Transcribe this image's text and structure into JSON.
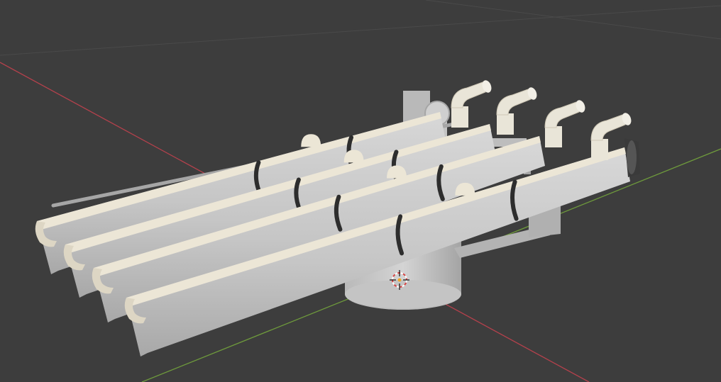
{
  "viewport": {
    "background": "#3d3d3d",
    "grid_color": "#4a4a4a",
    "x_axis_color": "#b4414c",
    "y_axis_color": "#6e9a3c"
  },
  "model": {
    "tube_count": 4,
    "body_color": "#c9c9c9",
    "body_shadow": "#a9a9a9",
    "liner_color": "#ece6d6",
    "band_color": "#2d2d2d",
    "elbow_color": "#e9e5d8"
  },
  "icons": {
    "cursor": "3d-cursor-icon"
  }
}
